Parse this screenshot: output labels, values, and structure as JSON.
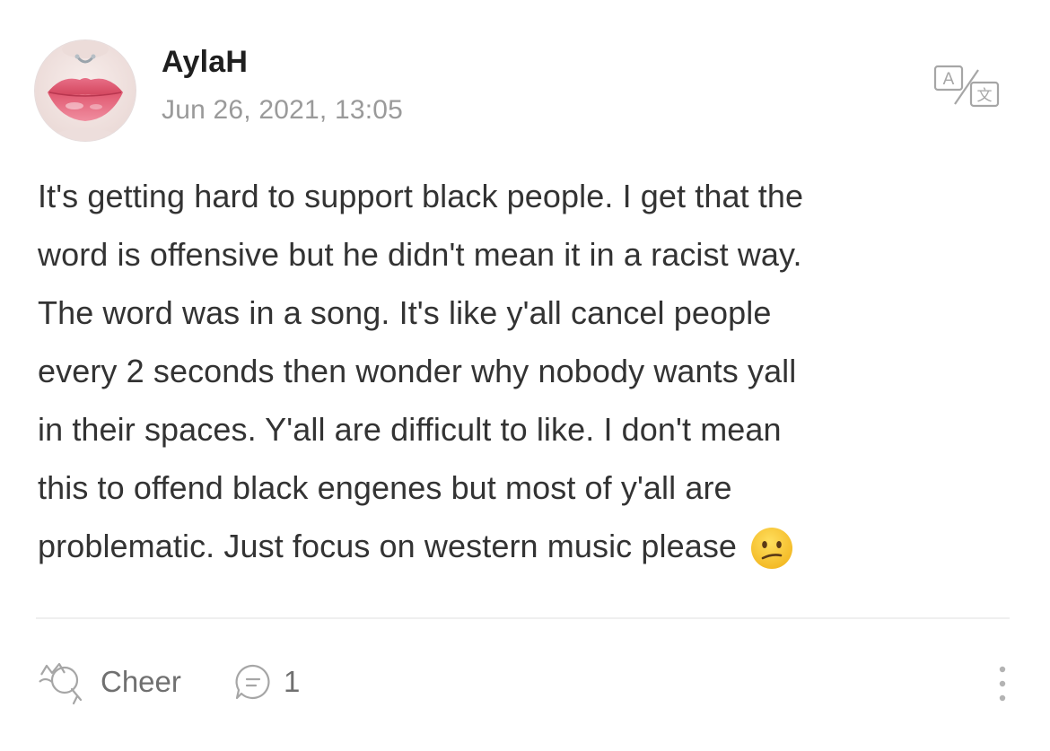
{
  "post": {
    "author": "AylaH",
    "timestamp": "Jun 26, 2021, 13:05",
    "body_lines": [
      "It's getting hard to support black people. I get that the",
      "word is offensive but he didn't mean it in a racist way.",
      "The word was in a song. It's like y'all cancel people",
      "every 2 seconds then wonder why nobody wants yall",
      "in their spaces. Y'all are difficult to like. I don't mean",
      "this to offend black engenes but most of y'all are",
      "problematic. Just focus on western music please"
    ],
    "trailing_emoji": "confused-face"
  },
  "translate_button": {
    "icon": "translate-icon",
    "glyph_latin": "A",
    "glyph_cjk": "文"
  },
  "actions": {
    "cheer_label": "Cheer",
    "cheer_icon": "cheer-hand-icon",
    "comment_icon": "comment-bubble-icon",
    "comment_count": "1",
    "more_icon": "more-vertical-icon"
  },
  "colors": {
    "author": "#1f1f1f",
    "timestamp": "#9a9a9a",
    "body_text": "#333333",
    "action_text": "#707070",
    "icon_gray": "#a6a6a6",
    "divider": "#efefef",
    "emoji_face": "#f7c531"
  }
}
